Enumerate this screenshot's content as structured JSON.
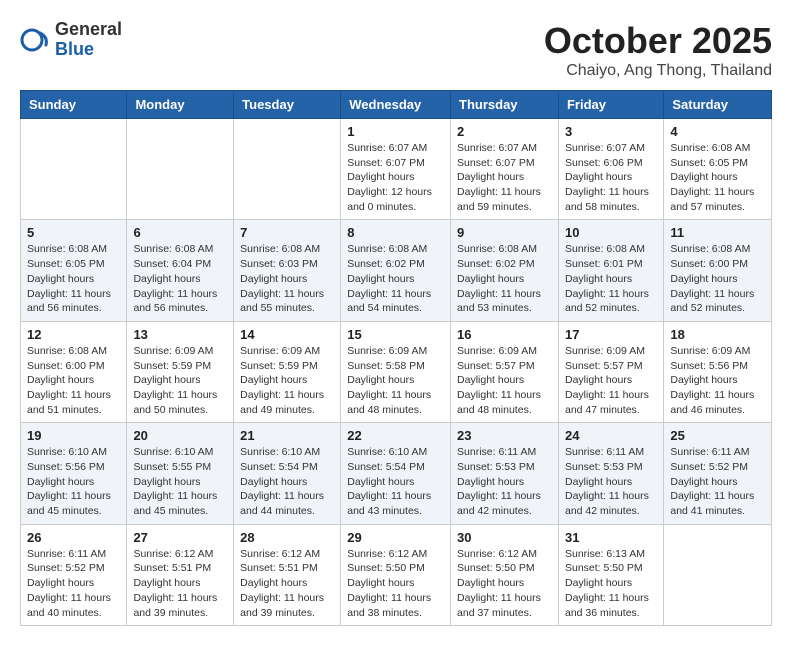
{
  "header": {
    "logo": {
      "general": "General",
      "blue": "Blue"
    },
    "month_title": "October 2025",
    "subtitle": "Chaiyo, Ang Thong, Thailand"
  },
  "weekdays": [
    "Sunday",
    "Monday",
    "Tuesday",
    "Wednesday",
    "Thursday",
    "Friday",
    "Saturday"
  ],
  "weeks": [
    [
      null,
      null,
      null,
      {
        "day": 1,
        "sunrise": "6:07 AM",
        "sunset": "6:07 PM",
        "daylight": "12 hours and 0 minutes."
      },
      {
        "day": 2,
        "sunrise": "6:07 AM",
        "sunset": "6:07 PM",
        "daylight": "11 hours and 59 minutes."
      },
      {
        "day": 3,
        "sunrise": "6:07 AM",
        "sunset": "6:06 PM",
        "daylight": "11 hours and 58 minutes."
      },
      {
        "day": 4,
        "sunrise": "6:08 AM",
        "sunset": "6:05 PM",
        "daylight": "11 hours and 57 minutes."
      }
    ],
    [
      {
        "day": 5,
        "sunrise": "6:08 AM",
        "sunset": "6:05 PM",
        "daylight": "11 hours and 56 minutes."
      },
      {
        "day": 6,
        "sunrise": "6:08 AM",
        "sunset": "6:04 PM",
        "daylight": "11 hours and 56 minutes."
      },
      {
        "day": 7,
        "sunrise": "6:08 AM",
        "sunset": "6:03 PM",
        "daylight": "11 hours and 55 minutes."
      },
      {
        "day": 8,
        "sunrise": "6:08 AM",
        "sunset": "6:02 PM",
        "daylight": "11 hours and 54 minutes."
      },
      {
        "day": 9,
        "sunrise": "6:08 AM",
        "sunset": "6:02 PM",
        "daylight": "11 hours and 53 minutes."
      },
      {
        "day": 10,
        "sunrise": "6:08 AM",
        "sunset": "6:01 PM",
        "daylight": "11 hours and 52 minutes."
      },
      {
        "day": 11,
        "sunrise": "6:08 AM",
        "sunset": "6:00 PM",
        "daylight": "11 hours and 52 minutes."
      }
    ],
    [
      {
        "day": 12,
        "sunrise": "6:08 AM",
        "sunset": "6:00 PM",
        "daylight": "11 hours and 51 minutes."
      },
      {
        "day": 13,
        "sunrise": "6:09 AM",
        "sunset": "5:59 PM",
        "daylight": "11 hours and 50 minutes."
      },
      {
        "day": 14,
        "sunrise": "6:09 AM",
        "sunset": "5:59 PM",
        "daylight": "11 hours and 49 minutes."
      },
      {
        "day": 15,
        "sunrise": "6:09 AM",
        "sunset": "5:58 PM",
        "daylight": "11 hours and 48 minutes."
      },
      {
        "day": 16,
        "sunrise": "6:09 AM",
        "sunset": "5:57 PM",
        "daylight": "11 hours and 48 minutes."
      },
      {
        "day": 17,
        "sunrise": "6:09 AM",
        "sunset": "5:57 PM",
        "daylight": "11 hours and 47 minutes."
      },
      {
        "day": 18,
        "sunrise": "6:09 AM",
        "sunset": "5:56 PM",
        "daylight": "11 hours and 46 minutes."
      }
    ],
    [
      {
        "day": 19,
        "sunrise": "6:10 AM",
        "sunset": "5:56 PM",
        "daylight": "11 hours and 45 minutes."
      },
      {
        "day": 20,
        "sunrise": "6:10 AM",
        "sunset": "5:55 PM",
        "daylight": "11 hours and 45 minutes."
      },
      {
        "day": 21,
        "sunrise": "6:10 AM",
        "sunset": "5:54 PM",
        "daylight": "11 hours and 44 minutes."
      },
      {
        "day": 22,
        "sunrise": "6:10 AM",
        "sunset": "5:54 PM",
        "daylight": "11 hours and 43 minutes."
      },
      {
        "day": 23,
        "sunrise": "6:11 AM",
        "sunset": "5:53 PM",
        "daylight": "11 hours and 42 minutes."
      },
      {
        "day": 24,
        "sunrise": "6:11 AM",
        "sunset": "5:53 PM",
        "daylight": "11 hours and 42 minutes."
      },
      {
        "day": 25,
        "sunrise": "6:11 AM",
        "sunset": "5:52 PM",
        "daylight": "11 hours and 41 minutes."
      }
    ],
    [
      {
        "day": 26,
        "sunrise": "6:11 AM",
        "sunset": "5:52 PM",
        "daylight": "11 hours and 40 minutes."
      },
      {
        "day": 27,
        "sunrise": "6:12 AM",
        "sunset": "5:51 PM",
        "daylight": "11 hours and 39 minutes."
      },
      {
        "day": 28,
        "sunrise": "6:12 AM",
        "sunset": "5:51 PM",
        "daylight": "11 hours and 39 minutes."
      },
      {
        "day": 29,
        "sunrise": "6:12 AM",
        "sunset": "5:50 PM",
        "daylight": "11 hours and 38 minutes."
      },
      {
        "day": 30,
        "sunrise": "6:12 AM",
        "sunset": "5:50 PM",
        "daylight": "11 hours and 37 minutes."
      },
      {
        "day": 31,
        "sunrise": "6:13 AM",
        "sunset": "5:50 PM",
        "daylight": "11 hours and 36 minutes."
      },
      null
    ]
  ]
}
